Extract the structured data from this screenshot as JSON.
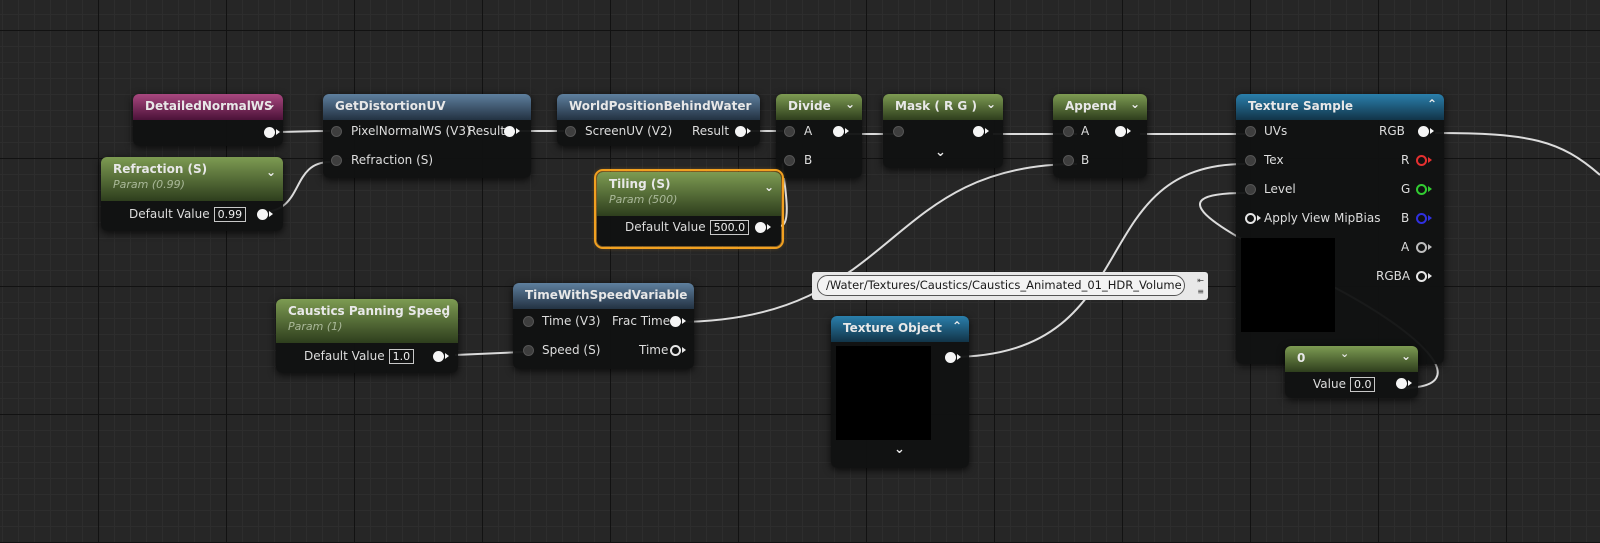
{
  "nodes": {
    "detailed_normal": {
      "title": "DetailedNormalWS"
    },
    "get_distortion": {
      "title": "GetDistortionUV",
      "inputs": [
        "PixelNormalWS (V3)",
        "Refraction (S)"
      ],
      "output": "Result"
    },
    "world_pos": {
      "title": "WorldPositionBehindWater",
      "input": "ScreenUV (V2)",
      "output": "Result"
    },
    "divide": {
      "title": "Divide",
      "inputs": [
        "A",
        "B"
      ]
    },
    "mask": {
      "title": "Mask ( R G )"
    },
    "append": {
      "title": "Append",
      "inputs": [
        "A",
        "B"
      ]
    },
    "texture_sample": {
      "title": "Texture Sample",
      "inputs": [
        "UVs",
        "Tex",
        "Level",
        "Apply View MipBias"
      ],
      "outputs": [
        "RGB",
        "R",
        "G",
        "B",
        "A",
        "RGBA"
      ]
    },
    "refraction": {
      "title": "Refraction (S)",
      "subtitle": "Param (0.99)",
      "label": "Default Value",
      "value": "0.99"
    },
    "tiling": {
      "title": "Tiling (S)",
      "subtitle": "Param (500)",
      "label": "Default Value",
      "value": "500.0"
    },
    "caustics_speed": {
      "title": "Caustics Panning Speed",
      "subtitle": "Param (1)",
      "label": "Default Value",
      "value": "1.0"
    },
    "time_speed": {
      "title": "TimeWithSpeedVariable",
      "inputs": [
        "Time (V3)",
        "Speed (S)"
      ],
      "outputs": [
        "Frac Time",
        "Time"
      ]
    },
    "texture_object": {
      "title": "Texture Object"
    },
    "constant": {
      "title": "0",
      "label": "Value",
      "value": "0.0"
    }
  },
  "tooltip": {
    "path": "/Water/Textures/Caustics/Caustics_Animated_01_HDR_Volume"
  },
  "icons": {
    "collapse": "chevron-down-icon",
    "expand": "chevron-up-icon"
  },
  "colors": {
    "selected_outline": "#f1a020",
    "pin_r": "#e53030",
    "pin_g": "#32cc32",
    "pin_b": "#3030e0"
  }
}
